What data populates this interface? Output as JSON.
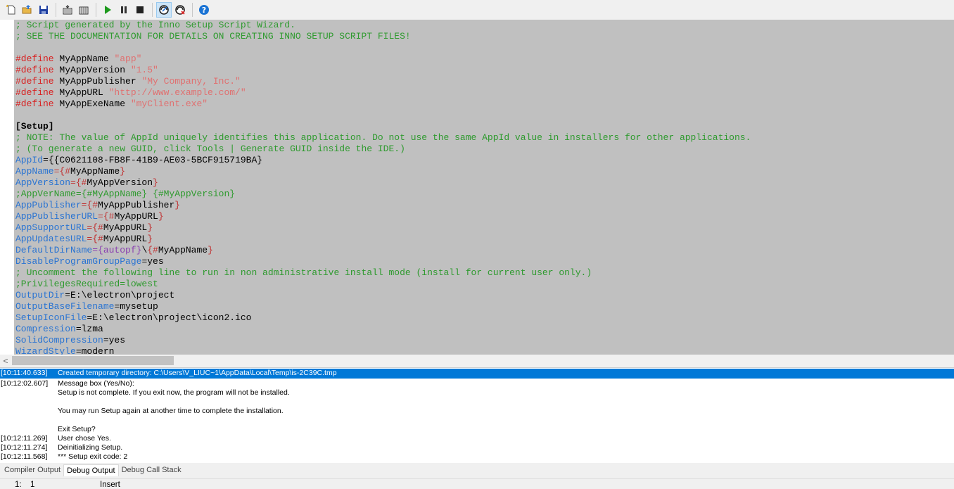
{
  "toolbar": {
    "buttons": [
      {
        "name": "new-file-icon"
      },
      {
        "name": "open-folder-icon"
      },
      {
        "name": "save-icon"
      },
      {
        "name": "compile-icon"
      },
      {
        "name": "stop-compile-icon"
      },
      {
        "name": "run-icon"
      },
      {
        "name": "pause-icon"
      },
      {
        "name": "stop-icon"
      },
      {
        "name": "target-setup-icon"
      },
      {
        "name": "target-uninstall-icon"
      },
      {
        "name": "help-icon"
      }
    ],
    "colors": {
      "run": "#1e9a1e",
      "help": "#1a73d4",
      "save": "#1f3fa0"
    }
  },
  "editor": {
    "lines": [
      [
        {
          "t": "com",
          "v": "; Script generated by the Inno Setup Script Wizard."
        }
      ],
      [
        {
          "t": "com",
          "v": "; SEE THE DOCUMENTATION FOR DETAILS ON CREATING INNO SETUP SCRIPT FILES!"
        }
      ],
      [],
      [
        {
          "t": "dir",
          "v": "#define"
        },
        {
          "t": "txt",
          "v": " MyAppName "
        },
        {
          "t": "str",
          "v": "\"app\""
        }
      ],
      [
        {
          "t": "dir",
          "v": "#define"
        },
        {
          "t": "txt",
          "v": " MyAppVersion "
        },
        {
          "t": "str",
          "v": "\"1.5\""
        }
      ],
      [
        {
          "t": "dir",
          "v": "#define"
        },
        {
          "t": "txt",
          "v": " MyAppPublisher "
        },
        {
          "t": "str",
          "v": "\"My Company, Inc.\""
        }
      ],
      [
        {
          "t": "dir",
          "v": "#define"
        },
        {
          "t": "txt",
          "v": " MyAppURL "
        },
        {
          "t": "str",
          "v": "\"http://www.example.com/\""
        }
      ],
      [
        {
          "t": "dir",
          "v": "#define"
        },
        {
          "t": "txt",
          "v": " MyAppExeName "
        },
        {
          "t": "str",
          "v": "\"myClient.exe\""
        }
      ],
      [],
      [
        {
          "t": "sec",
          "v": "[Setup]"
        }
      ],
      [
        {
          "t": "com",
          "v": "; NOTE: The value of AppId uniquely identifies this application. Do not use the same AppId value in installers for other applications."
        }
      ],
      [
        {
          "t": "com",
          "v": "; (To generate a new GUID, click Tools | Generate GUID inside the IDE.)"
        }
      ],
      [
        {
          "t": "key",
          "v": "AppId"
        },
        {
          "t": "txt",
          "v": "={{C0621108-FB8F-41B9-AE03-5BCF915719BA}"
        }
      ],
      [
        {
          "t": "key",
          "v": "AppName"
        },
        {
          "t": "brc",
          "v": "={#"
        },
        {
          "t": "txt",
          "v": "MyAppName"
        },
        {
          "t": "brc",
          "v": "}"
        }
      ],
      [
        {
          "t": "key",
          "v": "AppVersion"
        },
        {
          "t": "brc",
          "v": "={#"
        },
        {
          "t": "txt",
          "v": "MyAppVersion"
        },
        {
          "t": "brc",
          "v": "}"
        }
      ],
      [
        {
          "t": "com",
          "v": ";AppVerName={#MyAppName} {#MyAppVersion}"
        }
      ],
      [
        {
          "t": "key",
          "v": "AppPublisher"
        },
        {
          "t": "brc",
          "v": "={#"
        },
        {
          "t": "txt",
          "v": "MyAppPublisher"
        },
        {
          "t": "brc",
          "v": "}"
        }
      ],
      [
        {
          "t": "key",
          "v": "AppPublisherURL"
        },
        {
          "t": "brc",
          "v": "={#"
        },
        {
          "t": "txt",
          "v": "MyAppURL"
        },
        {
          "t": "brc",
          "v": "}"
        }
      ],
      [
        {
          "t": "key",
          "v": "AppSupportURL"
        },
        {
          "t": "brc",
          "v": "={#"
        },
        {
          "t": "txt",
          "v": "MyAppURL"
        },
        {
          "t": "brc",
          "v": "}"
        }
      ],
      [
        {
          "t": "key",
          "v": "AppUpdatesURL"
        },
        {
          "t": "brc",
          "v": "={#"
        },
        {
          "t": "txt",
          "v": "MyAppURL"
        },
        {
          "t": "brc",
          "v": "}"
        }
      ],
      [
        {
          "t": "key",
          "v": "DefaultDirName"
        },
        {
          "t": "con",
          "v": "={autopf}"
        },
        {
          "t": "txt",
          "v": "\\"
        },
        {
          "t": "brc",
          "v": "{#"
        },
        {
          "t": "txt",
          "v": "MyAppName"
        },
        {
          "t": "brc",
          "v": "}"
        }
      ],
      [
        {
          "t": "key",
          "v": "DisableProgramGroupPage"
        },
        {
          "t": "txt",
          "v": "=yes"
        }
      ],
      [
        {
          "t": "com",
          "v": "; Uncomment the following line to run in non administrative install mode (install for current user only.)"
        }
      ],
      [
        {
          "t": "com",
          "v": ";PrivilegesRequired=lowest"
        }
      ],
      [
        {
          "t": "key",
          "v": "OutputDir"
        },
        {
          "t": "txt",
          "v": "=E:\\electron\\project"
        }
      ],
      [
        {
          "t": "key",
          "v": "OutputBaseFilename"
        },
        {
          "t": "txt",
          "v": "=mysetup"
        }
      ],
      [
        {
          "t": "key",
          "v": "SetupIconFile"
        },
        {
          "t": "txt",
          "v": "=E:\\electron\\project\\icon2.ico"
        }
      ],
      [
        {
          "t": "key",
          "v": "Compression"
        },
        {
          "t": "txt",
          "v": "=lzma"
        }
      ],
      [
        {
          "t": "key",
          "v": "SolidCompression"
        },
        {
          "t": "txt",
          "v": "=yes"
        }
      ],
      [
        {
          "t": "key",
          "v": "WizardStyle"
        },
        {
          "t": "txt",
          "v": "=modern"
        }
      ]
    ]
  },
  "scrollbar": {
    "left_arrow": "<"
  },
  "output": {
    "rows": [
      {
        "ts": "[10:11:40.633]",
        "msg": "Created temporary directory: C:\\Users\\V_LIUC~1\\AppData\\Local\\Temp\\is-2C39C.tmp",
        "selected": true
      },
      {
        "ts": "[10:12:02.607]",
        "msg": "Message box (Yes/No):"
      },
      {
        "ts": "",
        "msg": "Setup is not complete. If you exit now, the program will not be installed."
      },
      {
        "ts": "",
        "msg": ""
      },
      {
        "ts": "",
        "msg": "You may run Setup again at another time to complete the installation."
      },
      {
        "ts": "",
        "msg": ""
      },
      {
        "ts": "",
        "msg": "Exit Setup?"
      },
      {
        "ts": "[10:12:11.269]",
        "msg": "User chose Yes."
      },
      {
        "ts": "[10:12:11.274]",
        "msg": "Deinitializing Setup."
      },
      {
        "ts": "[10:12:11.568]",
        "msg": "*** Setup exit code: 2"
      }
    ]
  },
  "tabs": [
    {
      "label": "Compiler Output",
      "active": false
    },
    {
      "label": "Debug Output",
      "active": true
    },
    {
      "label": "Debug Call Stack",
      "active": false
    }
  ],
  "status": {
    "line": "1:",
    "col": "1",
    "mode": "Insert"
  }
}
